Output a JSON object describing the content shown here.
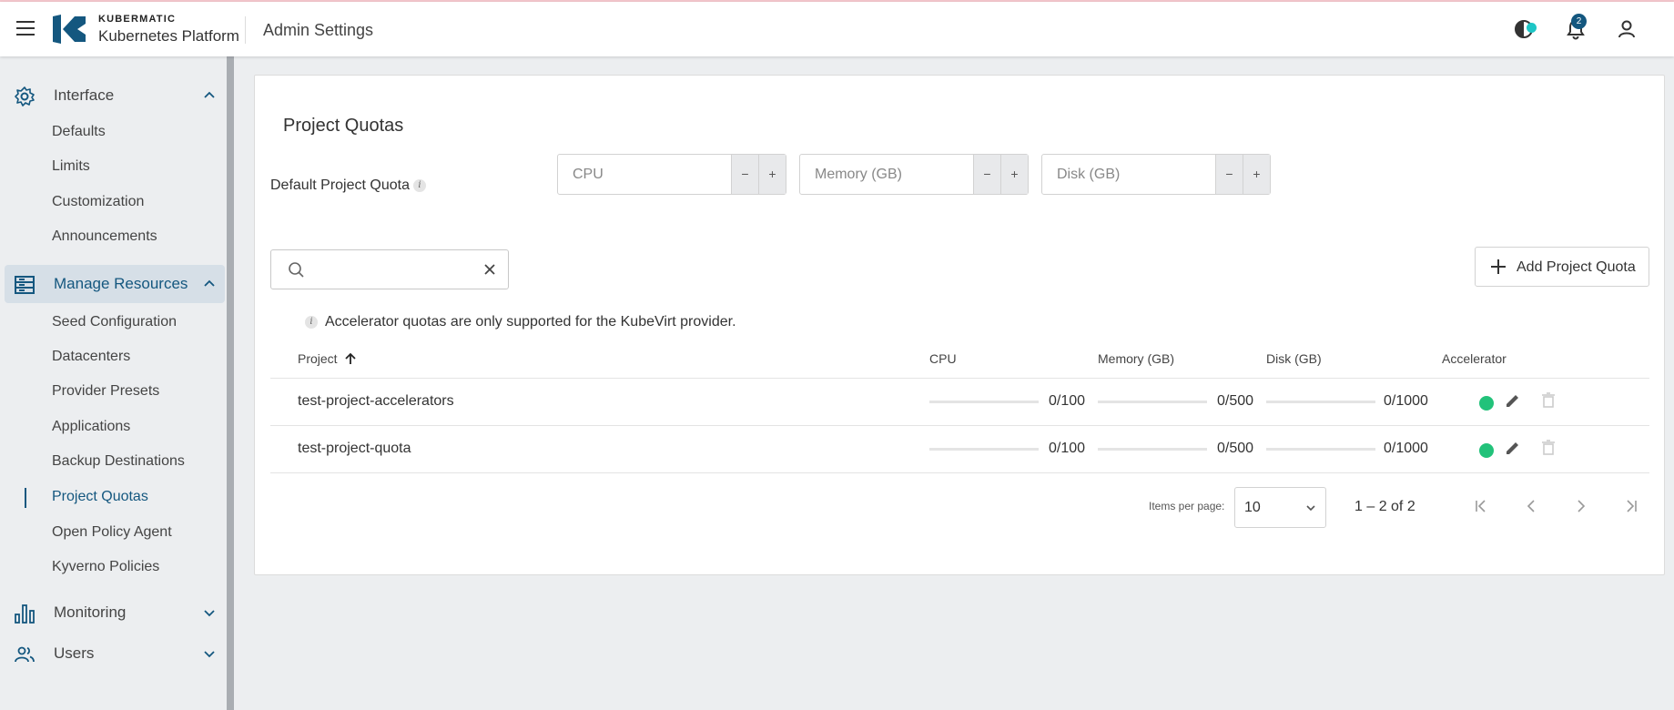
{
  "header": {
    "brand_small": "KUBERMATIC",
    "brand_big": "Kubernetes Platform",
    "title": "Admin Settings",
    "notification_count": "2",
    "icons": [
      "menu-icon",
      "kubermatic-logo",
      "theme-status-icon",
      "bell-icon",
      "account-icon"
    ],
    "status_color": "#1ec6c6",
    "badge_color": "#14577f"
  },
  "sidebar": {
    "groups": [
      {
        "label": "Interface",
        "icon": "gear-icon",
        "expanded": true,
        "items": [
          "Defaults",
          "Limits",
          "Customization",
          "Announcements"
        ]
      },
      {
        "label": "Manage Resources",
        "icon": "resources-icon",
        "expanded": true,
        "active": true,
        "items": [
          "Seed Configuration",
          "Datacenters",
          "Provider Presets",
          "Applications",
          "Backup Destinations",
          "Project Quotas",
          "Open Policy Agent",
          "Kyverno Policies"
        ]
      },
      {
        "label": "Monitoring",
        "icon": "bar-chart-icon",
        "expanded": false,
        "items": []
      },
      {
        "label": "Users",
        "icon": "users-icon",
        "expanded": false,
        "items": []
      }
    ],
    "selected_item": "Project Quotas",
    "accent_color": "#14577f"
  },
  "main": {
    "title": "Project Quotas",
    "default_quota_label": "Default Project Quota",
    "default_quota_inputs": [
      {
        "placeholder": "CPU",
        "value": ""
      },
      {
        "placeholder": "Memory (GB)",
        "value": ""
      },
      {
        "placeholder": "Disk (GB)",
        "value": ""
      }
    ],
    "stepper_minus": "−",
    "stepper_plus": "+",
    "search": {
      "placeholder": "",
      "value": ""
    },
    "add_button_label": "Add Project Quota",
    "accelerator_note": "Accelerator quotas are only supported for the KubeVirt provider.",
    "table": {
      "columns": [
        "Project",
        "CPU",
        "Memory (GB)",
        "Disk (GB)",
        "Accelerator"
      ],
      "sort": {
        "column": "Project",
        "direction": "asc"
      },
      "rows": [
        {
          "project": "test-project-accelerators",
          "cpu": "0/100",
          "memory": "0/500",
          "disk": "0/1000",
          "cpu_used": 0,
          "memory_used": 0,
          "disk_used": 0,
          "accelerator_color": "#22c27a"
        },
        {
          "project": "test-project-quota",
          "cpu": "0/100",
          "memory": "0/500",
          "disk": "0/1000",
          "cpu_used": 0,
          "memory_used": 0,
          "disk_used": 0,
          "accelerator_color": "#22c27a"
        }
      ]
    },
    "pagination": {
      "items_per_page_label": "Items per page:",
      "page_size": "10",
      "range": "1 – 2 of 2"
    }
  }
}
